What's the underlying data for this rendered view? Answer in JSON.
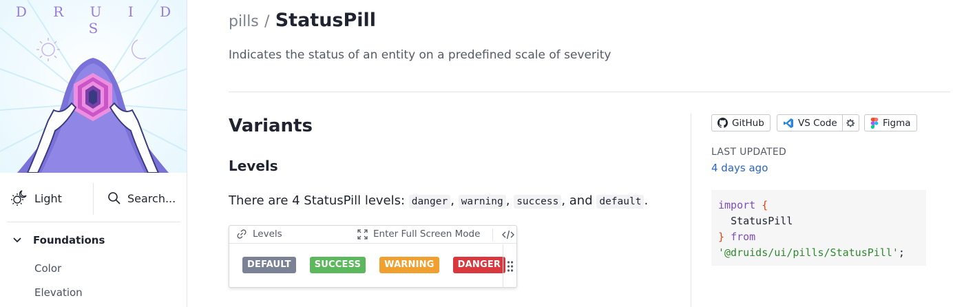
{
  "sidebar": {
    "brand": "D R U I D S",
    "theme_label": "Light",
    "search_label": "Search...",
    "group_label": "Foundations",
    "items": [
      "Color",
      "Elevation"
    ]
  },
  "header": {
    "breadcrumb_parent": "pills",
    "breadcrumb_sep": "/",
    "title": "StatusPill",
    "description": "Indicates the status of an entity on a predefined scale of severity"
  },
  "content": {
    "section_title": "Variants",
    "subsection_title": "Levels",
    "paragraph": {
      "prefix": "There are 4 StatusPill levels: ",
      "codes": [
        "danger",
        "warning",
        "success",
        "default"
      ],
      "sep1": ", ",
      "sep2": ", ",
      "sep3": ", and ",
      "suffix": "."
    },
    "example": {
      "levels_label": "Levels",
      "fullscreen_label": "Enter Full Screen Mode",
      "pills": [
        {
          "label": "DEFAULT",
          "color": "#7b8296"
        },
        {
          "label": "SUCCESS",
          "color": "#5cb85c"
        },
        {
          "label": "WARNING",
          "color": "#f0a030"
        },
        {
          "label": "DANGER",
          "color": "#d9383e"
        }
      ]
    }
  },
  "aside": {
    "github_label": "GitHub",
    "vscode_label": "VS Code",
    "figma_label": "Figma",
    "last_updated_label": "LAST UPDATED",
    "last_updated_value": "4 days ago",
    "code": {
      "kw_import": "import",
      "brace_open": "{",
      "name": "StatusPill",
      "brace_close": "}",
      "kw_from": "from",
      "path": "'@druids/ui/pills/StatusPill'",
      "semi": ";"
    }
  },
  "colors": {
    "link": "#2a64c4",
    "brand_purple": "#9b7ad9"
  }
}
